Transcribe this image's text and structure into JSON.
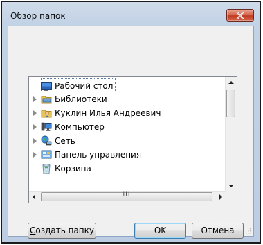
{
  "window": {
    "title": "Обзор папок"
  },
  "tree": {
    "items": [
      {
        "label": "Рабочий стол",
        "icon": "desktop-icon",
        "expander": false,
        "selected": true
      },
      {
        "label": "Библиотеки",
        "icon": "libraries-icon",
        "expander": true
      },
      {
        "label": "Куклин Илья Андреевич",
        "icon": "user-folder-icon",
        "expander": true
      },
      {
        "label": "Компьютер",
        "icon": "computer-icon",
        "expander": true
      },
      {
        "label": "Сеть",
        "icon": "network-icon",
        "expander": true
      },
      {
        "label": "Панель управления",
        "icon": "control-panel-icon",
        "expander": true
      },
      {
        "label": "Корзина",
        "icon": "recycle-bin-icon",
        "expander": false
      }
    ],
    "hscroll_grip": "III"
  },
  "buttons": {
    "new_folder": "Создать папку",
    "ok": "OK",
    "cancel": "Отмена"
  }
}
